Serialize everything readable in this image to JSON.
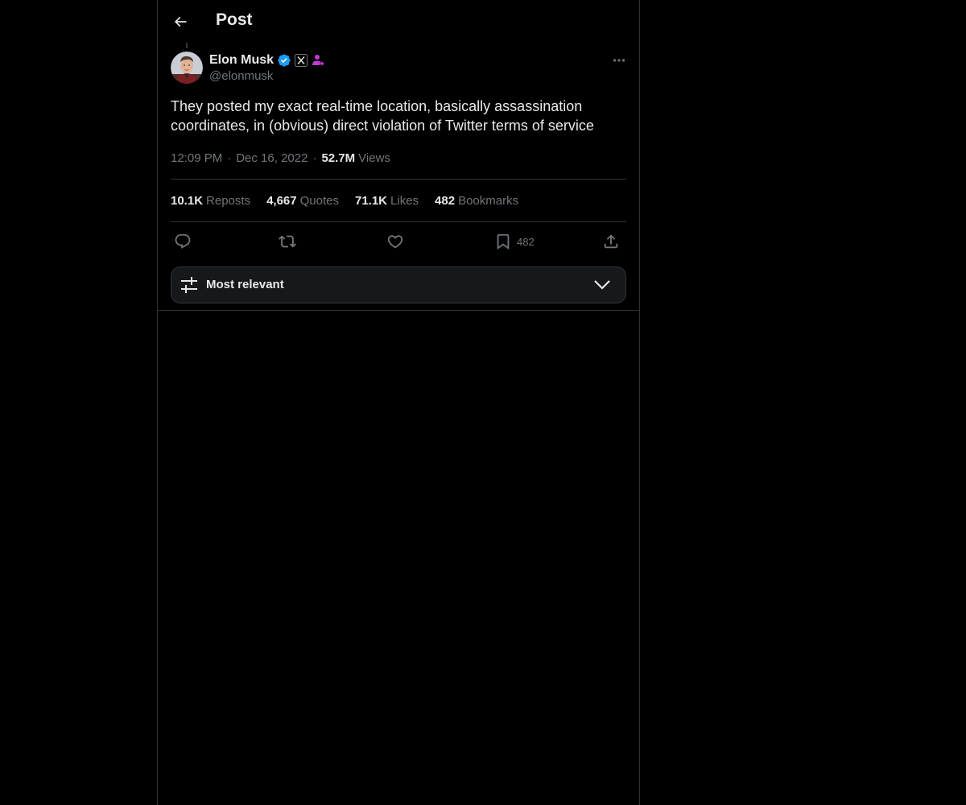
{
  "header": {
    "title": "Post"
  },
  "post": {
    "author": {
      "display_name": "Elon Musk",
      "handle": "@elonmusk",
      "verified": true,
      "affiliation_badge": "X",
      "avatar_icon": "user-avatar-photo"
    },
    "text": "They posted my exact real-time location, basically assassination coordinates, in (obvious) direct violation of Twitter terms of service",
    "time": "12:09 PM",
    "date": "Dec 16, 2022",
    "views_count": "52.7M",
    "views_label": "Views",
    "separator": "·"
  },
  "stats": {
    "reposts": {
      "count": "10.1K",
      "label": "Reposts"
    },
    "quotes": {
      "count": "4,667",
      "label": "Quotes"
    },
    "likes": {
      "count": "71.1K",
      "label": "Likes"
    },
    "bookmarks": {
      "count": "482",
      "label": "Bookmarks"
    }
  },
  "actions": {
    "reply_icon": "reply-icon",
    "repost_icon": "repost-icon",
    "like_icon": "heart-icon",
    "bookmark_icon": "bookmark-icon",
    "bookmark_count": "482",
    "share_icon": "share-icon"
  },
  "sort": {
    "label": "Most relevant"
  },
  "colors": {
    "background": "#000000",
    "text": "#e7e9ea",
    "muted": "#71767b",
    "border": "#2f3336",
    "verified_blue": "#1d9bf0",
    "badge_purple": "#c13bd2"
  }
}
